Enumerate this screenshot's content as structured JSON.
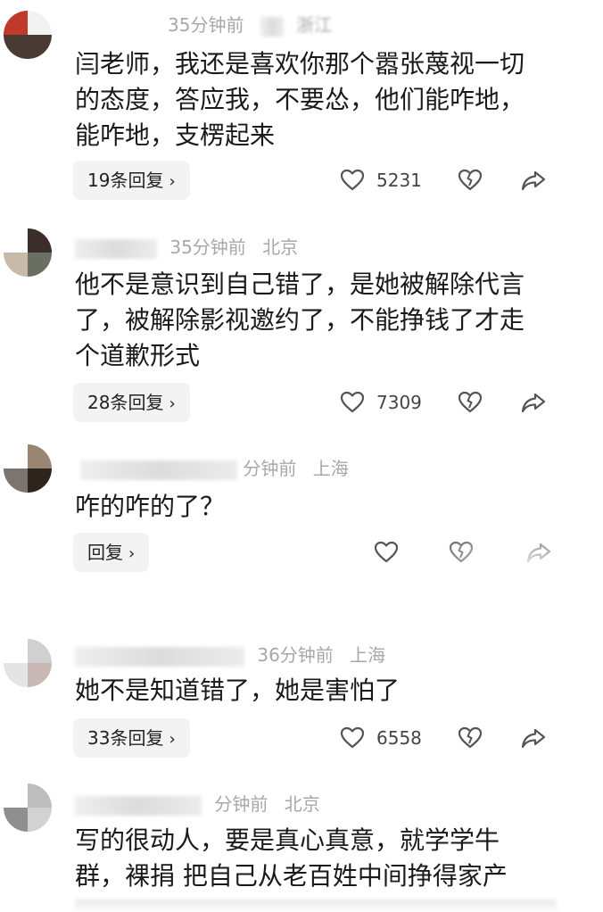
{
  "comments": [
    {
      "time": "35分钟前",
      "location": "浙江",
      "text": "闫老师，我还是喜欢你那个嚣张蔑视一切的态度，答应我，不要怂，他们能咋地，能咋地，支楞起来",
      "replies_label": "19条回复",
      "likes": "5231",
      "avatar_colors": [
        "#c0392b",
        "#f2f2f2",
        "#4a3a34",
        "#4a3a34"
      ]
    },
    {
      "time": "35分钟前",
      "location": "北京",
      "text": "他不是意识到自己错了，是她被解除代言了，被解除影视邀约了，不能挣钱了才走个道歉形式",
      "replies_label": "28条回复",
      "likes": "7309",
      "avatar_colors": [
        "#ffffff",
        "#3b2e2a",
        "#c9b9aa",
        "#6b6f63"
      ]
    },
    {
      "time": "分钟前",
      "location": "上海",
      "text": "咋的咋的了？",
      "replies_label": "回复",
      "likes": "",
      "avatar_colors": [
        "#ffffff",
        "#9a8570",
        "#7a7570",
        "#2d241e"
      ]
    },
    {
      "time": "36分钟前",
      "location": "上海",
      "text": "她不是知道错了，她是害怕了",
      "replies_label": "33条回复",
      "likes": "6558",
      "avatar_colors": [
        "#ffffff",
        "#d0d0d0",
        "#e4e4e4",
        "#c8b7b3"
      ]
    },
    {
      "time": "分钟前",
      "location": "北京",
      "text": "写的很动人，要是真心真意，就学学牛群，裸捐 把自己从老百姓中间挣得家产",
      "replies_label": "",
      "likes": "",
      "avatar_colors": [
        "#ffffff",
        "#bdbdbd",
        "#8f8f8f",
        "#d2d2d2"
      ]
    }
  ],
  "icons": {
    "like": "heart-outline-icon",
    "dislike": "broken-heart-icon",
    "share": "share-arrow-icon",
    "reply_chevron": "chevron-right-icon"
  },
  "colors": {
    "meta_text": "#a8a8a8",
    "reply_bg": "#f3f3f3",
    "icon_stroke": "#555555"
  }
}
